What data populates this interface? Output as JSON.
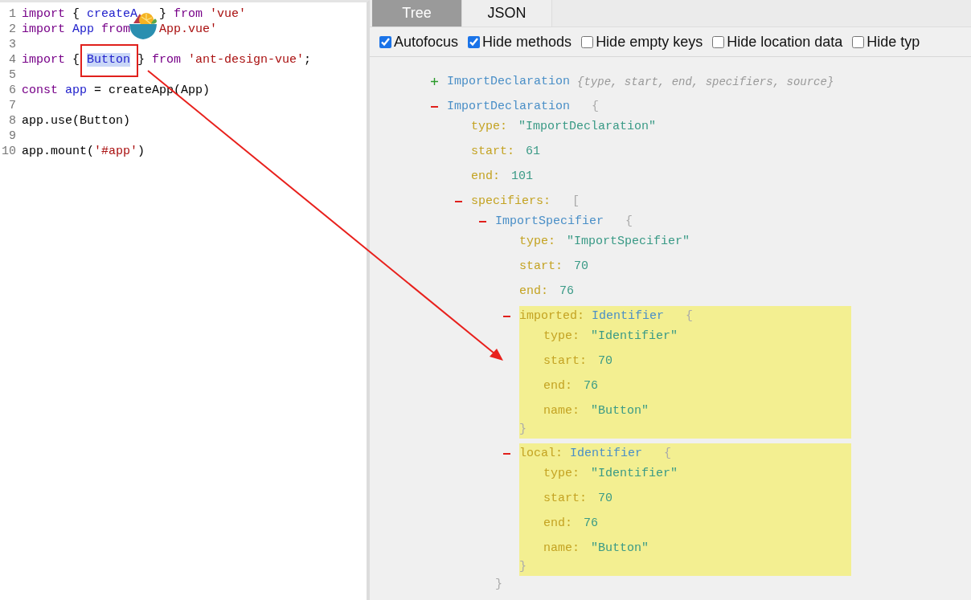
{
  "editor": {
    "lines": [
      {
        "number": "1",
        "tokens": [
          {
            "text": "import",
            "kind": "keyword"
          },
          {
            "text": " { ",
            "kind": "plain"
          },
          {
            "text": "createA",
            "kind": "name"
          },
          {
            "kind": "gap"
          },
          {
            "text": "} ",
            "kind": "plain"
          },
          {
            "text": "from",
            "kind": "keyword"
          },
          {
            "text": " 'vue'",
            "kind": "string"
          }
        ]
      },
      {
        "number": "2",
        "tokens": [
          {
            "text": "import ",
            "kind": "keyword"
          },
          {
            "text": "App ",
            "kind": "name"
          },
          {
            "text": "from ",
            "kind": "keyword"
          },
          {
            "kind": "gap"
          },
          {
            "text": "App.vue'",
            "kind": "string"
          }
        ]
      },
      {
        "number": "3"
      },
      {
        "number": "4",
        "tokens": [
          {
            "text": "import",
            "kind": "keyword"
          },
          {
            "text": " { ",
            "kind": "plain"
          },
          {
            "text": "Button",
            "kind": "selection"
          },
          {
            "text": " } ",
            "kind": "plain"
          },
          {
            "text": "from",
            "kind": "keyword"
          },
          {
            "text": " 'ant-design-vue'",
            "kind": "string"
          },
          {
            "text": ";",
            "kind": "plain"
          }
        ]
      },
      {
        "number": "5"
      },
      {
        "number": "6",
        "tokens": [
          {
            "text": "const ",
            "kind": "keyword"
          },
          {
            "text": "app",
            "kind": "name"
          },
          {
            "text": " = createApp(App)",
            "kind": "plain"
          }
        ]
      },
      {
        "number": "7"
      },
      {
        "number": "8",
        "tokens": [
          {
            "text": "app.use(Button)",
            "kind": "plain"
          }
        ]
      },
      {
        "number": "9"
      },
      {
        "number": "10",
        "tokens": [
          {
            "text": "app.mount(",
            "kind": "plain"
          },
          {
            "text": "'#app'",
            "kind": "string"
          },
          {
            "text": ")",
            "kind": "plain"
          }
        ]
      }
    ]
  },
  "tabs": [
    {
      "label": "Tree",
      "selected": true
    },
    {
      "label": "JSON",
      "selected": false
    }
  ],
  "options": [
    {
      "label": "Autofocus",
      "checked": true
    },
    {
      "label": "Hide methods",
      "checked": true
    },
    {
      "label": "Hide empty keys",
      "checked": false
    },
    {
      "label": "Hide location data",
      "checked": false
    },
    {
      "label": "Hide typ",
      "checked": false
    }
  ],
  "tree": [
    {
      "kind": "node",
      "label": "ImportDeclaration",
      "expanded": false,
      "summary": "{type, start, end, specifiers, source}"
    },
    {
      "kind": "node",
      "label": "ImportDeclaration",
      "expanded": true,
      "open": "{",
      "children": [
        {
          "kind": "property",
          "key": "type:",
          "value": "\"ImportDeclaration\""
        },
        {
          "kind": "property",
          "key": "start:",
          "value": "61"
        },
        {
          "kind": "property",
          "key": "end:",
          "value": "101"
        },
        {
          "kind": "node",
          "key": "specifiers:",
          "expanded": true,
          "open": "[",
          "children": [
            {
              "kind": "node",
              "label": "ImportSpecifier",
              "expanded": true,
              "open": "{",
              "close": "}",
              "children": [
                {
                  "kind": "property",
                  "key": "type:",
                  "value": "\"ImportSpecifier\""
                },
                {
                  "kind": "property",
                  "key": "start:",
                  "value": "70"
                },
                {
                  "kind": "property",
                  "key": "end:",
                  "value": "76"
                },
                {
                  "kind": "node",
                  "key": "imported:",
                  "label": "Identifier",
                  "expanded": true,
                  "highlighted": true,
                  "open": "{",
                  "close": "}",
                  "children": [
                    {
                      "kind": "property",
                      "key": "type:",
                      "value": "\"Identifier\""
                    },
                    {
                      "kind": "property",
                      "key": "start:",
                      "value": "70"
                    },
                    {
                      "kind": "property",
                      "key": "end:",
                      "value": "76"
                    },
                    {
                      "kind": "property",
                      "key": "name:",
                      "value": "\"Button\""
                    }
                  ]
                },
                {
                  "kind": "node",
                  "key": "local:",
                  "label": "Identifier",
                  "expanded": true,
                  "highlighted": true,
                  "open": "{",
                  "close": "}",
                  "children": [
                    {
                      "kind": "property",
                      "key": "type:",
                      "value": "\"Identifier\""
                    },
                    {
                      "kind": "property",
                      "key": "start:",
                      "value": "70"
                    },
                    {
                      "kind": "property",
                      "key": "end:",
                      "value": "76"
                    },
                    {
                      "kind": "property",
                      "key": "name:",
                      "value": "\"Button\""
                    }
                  ]
                }
              ]
            }
          ]
        }
      ]
    }
  ]
}
